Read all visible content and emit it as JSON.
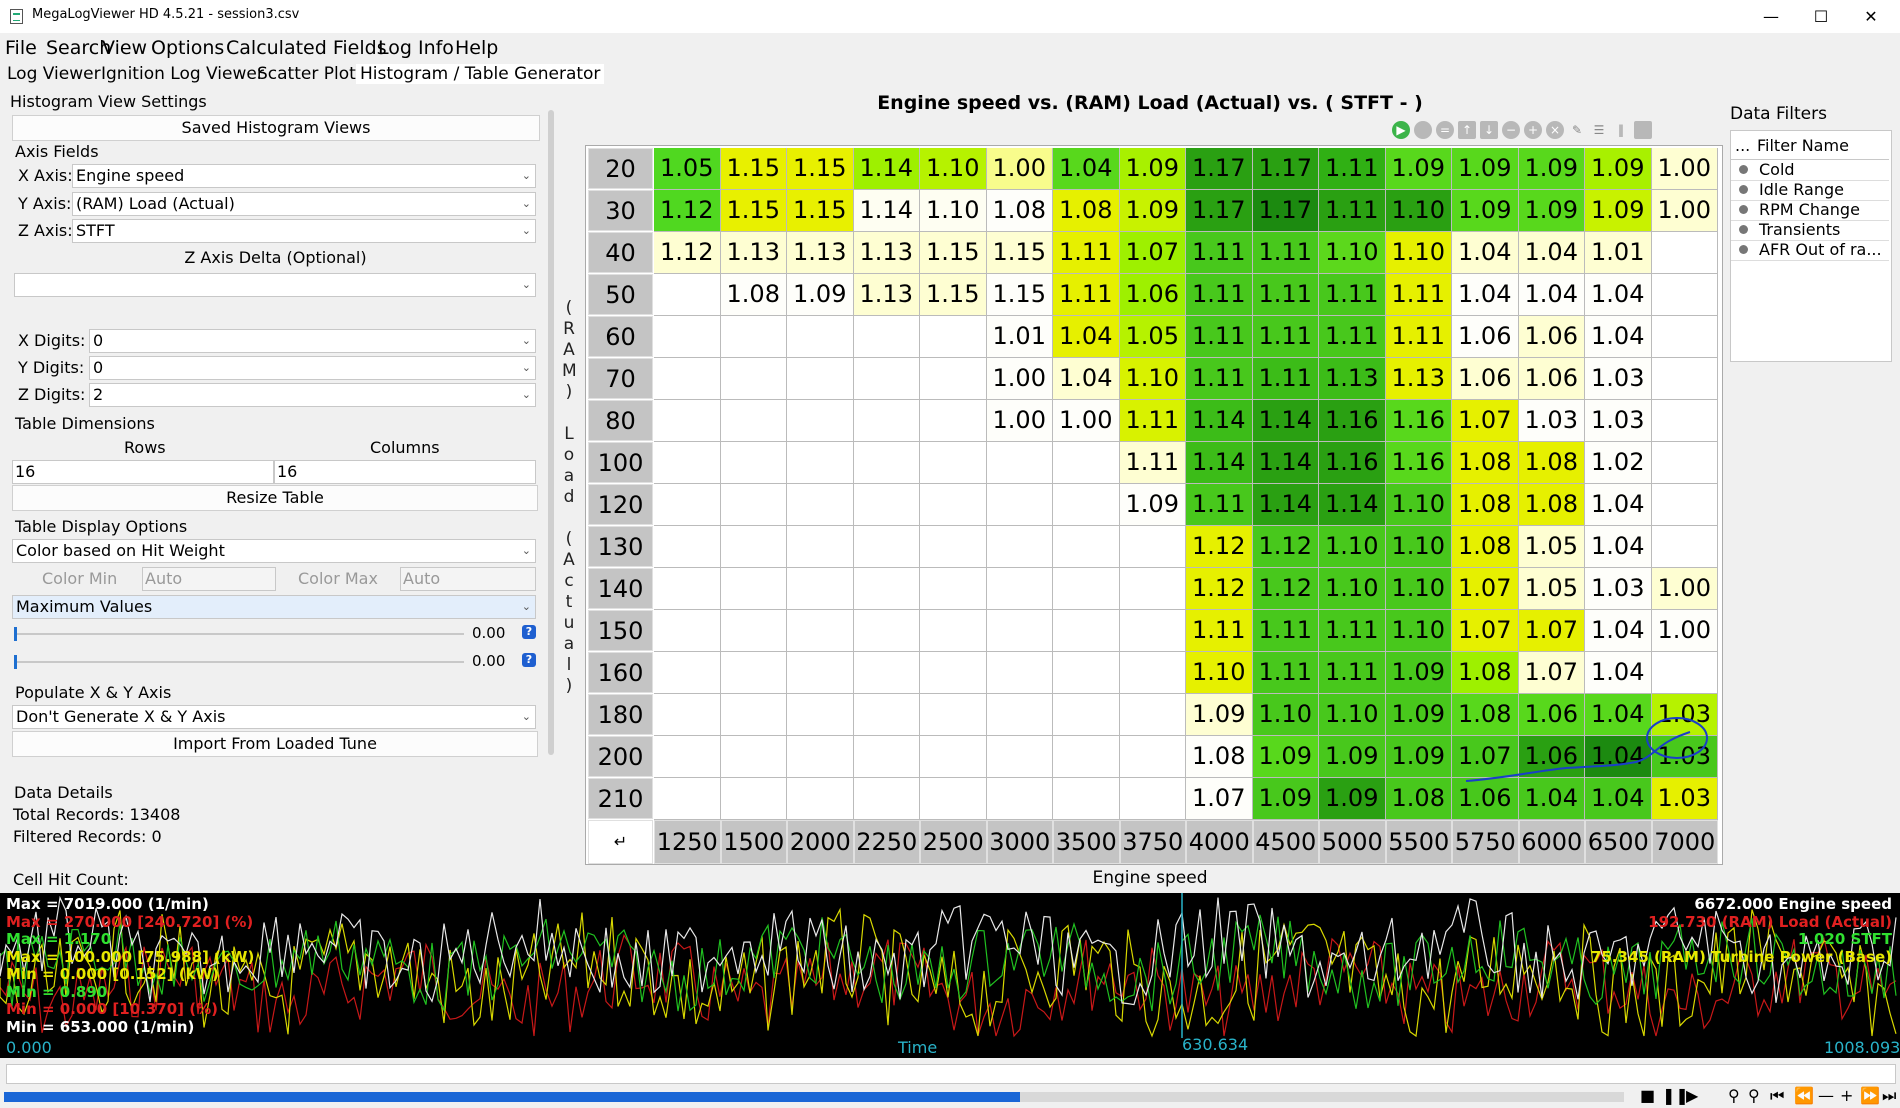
{
  "window": {
    "title": "MegaLogViewer HD 4.5.21 - session3.csv"
  },
  "menu": [
    "File",
    "Search",
    "View",
    "Options",
    "Calculated Fields",
    "Log Info",
    "Help"
  ],
  "tabs": [
    "Log Viewer",
    "Ignition Log Viewer",
    "Scatter Plots",
    "Histogram / Table Generator"
  ],
  "settings": {
    "header": "Histogram View Settings",
    "saved_views_button": "Saved Histogram Views",
    "axis_fields_label": "Axis Fields",
    "x_axis_label": "X Axis:",
    "x_axis_value": "Engine speed",
    "y_axis_label": "Y Axis:",
    "y_axis_value": "(RAM) Load (Actual)",
    "z_axis_label": "Z Axis:",
    "z_axis_value": "STFT",
    "z_delta_label": "Z Axis Delta (Optional)",
    "z_delta_value": "",
    "x_digits_label": "X Digits:",
    "x_digits_value": "0",
    "y_digits_label": "Y Digits:",
    "y_digits_value": "0",
    "z_digits_label": "Z Digits:",
    "z_digits_value": "2",
    "table_dimensions_label": "Table Dimensions",
    "rows_label": "Rows",
    "columns_label": "Columns",
    "rows_value": "16",
    "columns_value": "16",
    "resize_button": "Resize Table",
    "display_options_label": "Table Display Options",
    "color_mode": "Color based on Hit Weight",
    "color_min_label": "Color Min",
    "color_min_placeholder": "Auto",
    "color_max_label": "Color Max",
    "color_max_placeholder": "Auto",
    "value_mode": "Maximum Values",
    "slider1_value": "0.00",
    "slider2_value": "0.00",
    "populate_label": "Populate X & Y Axis",
    "populate_value": "Don't Generate X & Y Axis",
    "import_button": "Import From Loaded Tune",
    "data_details_label": "Data Details",
    "total_records": "Total Records: 13408",
    "filtered_records": "Filtered Records: 0",
    "cell_hit_count": "Cell Hit Count:"
  },
  "histogram": {
    "title": "Engine speed vs. (RAM) Load (Actual) vs. ( STFT -   )",
    "x_label": "Engine speed",
    "y_label": "(RAM) Load (Actual)",
    "corner_symbol": "↵",
    "x_values": [
      "1250",
      "1500",
      "2000",
      "2250",
      "2500",
      "3000",
      "3500",
      "3750",
      "4000",
      "4500",
      "5000",
      "5500",
      "5750",
      "6000",
      "6500",
      "7000"
    ],
    "y_values": [
      "20",
      "30",
      "40",
      "50",
      "60",
      "70",
      "80",
      "100",
      "120",
      "130",
      "140",
      "150",
      "160",
      "180",
      "200",
      "210"
    ],
    "cells": [
      [
        "1.05",
        "1.15",
        "1.15",
        "1.14",
        "1.10",
        "1.00",
        "1.04",
        "1.09",
        "1.17",
        "1.17",
        "1.11",
        "1.09",
        "1.09",
        "1.09",
        "1.09",
        "1.00"
      ],
      [
        "1.12",
        "1.15",
        "1.15",
        "1.14",
        "1.10",
        "1.08",
        "1.08",
        "1.09",
        "1.17",
        "1.17",
        "1.11",
        "1.10",
        "1.09",
        "1.09",
        "1.09",
        "1.00"
      ],
      [
        "1.12",
        "1.13",
        "1.13",
        "1.13",
        "1.15",
        "1.15",
        "1.11",
        "1.07",
        "1.11",
        "1.11",
        "1.10",
        "1.10",
        "1.04",
        "1.04",
        "1.01",
        ""
      ],
      [
        "",
        "1.08",
        "1.09",
        "1.13",
        "1.15",
        "1.15",
        "1.11",
        "1.06",
        "1.11",
        "1.11",
        "1.11",
        "1.11",
        "1.04",
        "1.04",
        "1.04",
        ""
      ],
      [
        "",
        "",
        "",
        "",
        "",
        "1.01",
        "1.04",
        "1.05",
        "1.11",
        "1.11",
        "1.11",
        "1.11",
        "1.06",
        "1.06",
        "1.04",
        ""
      ],
      [
        "",
        "",
        "",
        "",
        "",
        "1.00",
        "1.04",
        "1.10",
        "1.11",
        "1.11",
        "1.13",
        "1.13",
        "1.06",
        "1.06",
        "1.03",
        ""
      ],
      [
        "",
        "",
        "",
        "",
        "",
        "1.00",
        "1.00",
        "1.11",
        "1.14",
        "1.14",
        "1.16",
        "1.16",
        "1.07",
        "1.03",
        "1.03",
        ""
      ],
      [
        "",
        "",
        "",
        "",
        "",
        "",
        "",
        "1.11",
        "1.14",
        "1.14",
        "1.16",
        "1.16",
        "1.08",
        "1.08",
        "1.02",
        ""
      ],
      [
        "",
        "",
        "",
        "",
        "",
        "",
        "",
        "1.09",
        "1.11",
        "1.14",
        "1.14",
        "1.10",
        "1.08",
        "1.08",
        "1.04",
        ""
      ],
      [
        "",
        "",
        "",
        "",
        "",
        "",
        "",
        "",
        "1.12",
        "1.12",
        "1.10",
        "1.10",
        "1.08",
        "1.05",
        "1.04",
        ""
      ],
      [
        "",
        "",
        "",
        "",
        "",
        "",
        "",
        "",
        "1.12",
        "1.12",
        "1.10",
        "1.10",
        "1.07",
        "1.05",
        "1.03",
        "1.00"
      ],
      [
        "",
        "",
        "",
        "",
        "",
        "",
        "",
        "",
        "1.11",
        "1.11",
        "1.11",
        "1.10",
        "1.07",
        "1.07",
        "1.04",
        "1.00"
      ],
      [
        "",
        "",
        "",
        "",
        "",
        "",
        "",
        "",
        "1.10",
        "1.11",
        "1.11",
        "1.09",
        "1.08",
        "1.07",
        "1.04",
        ""
      ],
      [
        "",
        "",
        "",
        "",
        "",
        "",
        "",
        "",
        "1.09",
        "1.10",
        "1.10",
        "1.09",
        "1.08",
        "1.06",
        "1.04",
        "1.03"
      ],
      [
        "",
        "",
        "",
        "",
        "",
        "",
        "",
        "",
        "1.08",
        "1.09",
        "1.09",
        "1.09",
        "1.07",
        "1.06",
        "1.04",
        "1.03"
      ],
      [
        "",
        "",
        "",
        "",
        "",
        "",
        "",
        "",
        "1.07",
        "1.09",
        "1.09",
        "1.08",
        "1.06",
        "1.04",
        "1.04",
        "1.03"
      ]
    ],
    "heat_colors": [
      [
        "#50d820",
        "#e8f000",
        "#e8f000",
        "#9ef000",
        "#b6f200",
        "#f8fc8c",
        "#58d81c",
        "#a8f000",
        "#2aa012",
        "#2aa012",
        "#30b014",
        "#58d81c",
        "#58d81c",
        "#58d81c",
        "#a8f000",
        "#fefed2"
      ],
      [
        "#50d820",
        "#e8f000",
        "#e8f000",
        "#fefef2",
        "#fefef2",
        "#fefefa",
        "#e6f000",
        "#c8f200",
        "#2aa012",
        "#1c8a10",
        "#2aa012",
        "#2aa012",
        "#58d81c",
        "#58d81c",
        "#c8f200",
        "#fefed2"
      ],
      [
        "#fefed2",
        "#fefed2",
        "#fefed2",
        "#fefed2",
        "#fefed2",
        "#fefed2",
        "#e6f000",
        "#9ef000",
        "#48c81c",
        "#48c81c",
        "#5cd81c",
        "#e6f000",
        "#fefed2",
        "#fefed2",
        "#fefed2",
        "#ffffff"
      ],
      [
        "#ffffff",
        "#fefefa",
        "#fefefa",
        "#fefed2",
        "#fefed2",
        "#fefefa",
        "#e6f000",
        "#9ef000",
        "#48c81c",
        "#48c81c",
        "#48c81c",
        "#e6f000",
        "#fefefa",
        "#fefefa",
        "#fefefa",
        "#ffffff"
      ],
      [
        "#ffffff",
        "#ffffff",
        "#ffffff",
        "#ffffff",
        "#ffffff",
        "#fefefa",
        "#e6f000",
        "#b6f200",
        "#48c81c",
        "#48c81c",
        "#48c81c",
        "#e6f000",
        "#fefefa",
        "#fefed2",
        "#fefefa",
        "#ffffff"
      ],
      [
        "#ffffff",
        "#ffffff",
        "#ffffff",
        "#ffffff",
        "#ffffff",
        "#fefefa",
        "#fefed2",
        "#d8f200",
        "#48c81c",
        "#3cbc18",
        "#3cbc18",
        "#e6f000",
        "#fefed2",
        "#fefed2",
        "#fefefa",
        "#ffffff"
      ],
      [
        "#ffffff",
        "#ffffff",
        "#ffffff",
        "#ffffff",
        "#ffffff",
        "#fefefa",
        "#fefefa",
        "#d8f200",
        "#3cbc18",
        "#2aa012",
        "#2aa012",
        "#58d81c",
        "#e6f000",
        "#fefefa",
        "#fefefa",
        "#ffffff"
      ],
      [
        "#ffffff",
        "#ffffff",
        "#ffffff",
        "#ffffff",
        "#ffffff",
        "#ffffff",
        "#ffffff",
        "#fefed2",
        "#3cbc18",
        "#2aa012",
        "#2aa012",
        "#58d81c",
        "#e6f000",
        "#e6f000",
        "#fefefa",
        "#ffffff"
      ],
      [
        "#ffffff",
        "#ffffff",
        "#ffffff",
        "#ffffff",
        "#ffffff",
        "#ffffff",
        "#ffffff",
        "#fefefa",
        "#48c81c",
        "#2aa012",
        "#2aa012",
        "#48c81c",
        "#e6f000",
        "#e6f000",
        "#fefefa",
        "#ffffff"
      ],
      [
        "#ffffff",
        "#ffffff",
        "#ffffff",
        "#ffffff",
        "#ffffff",
        "#ffffff",
        "#ffffff",
        "#ffffff",
        "#e6f000",
        "#48c81c",
        "#48c81c",
        "#48c81c",
        "#e6f000",
        "#fefed2",
        "#fefefa",
        "#ffffff"
      ],
      [
        "#ffffff",
        "#ffffff",
        "#ffffff",
        "#ffffff",
        "#ffffff",
        "#ffffff",
        "#ffffff",
        "#ffffff",
        "#e6f000",
        "#48c81c",
        "#48c81c",
        "#48c81c",
        "#e6f000",
        "#fefed2",
        "#fefefa",
        "#fefed2"
      ],
      [
        "#ffffff",
        "#ffffff",
        "#ffffff",
        "#ffffff",
        "#ffffff",
        "#ffffff",
        "#ffffff",
        "#ffffff",
        "#e6f000",
        "#48c81c",
        "#48c81c",
        "#48c81c",
        "#e6f000",
        "#e6f000",
        "#fefefa",
        "#fefefa"
      ],
      [
        "#ffffff",
        "#ffffff",
        "#ffffff",
        "#ffffff",
        "#ffffff",
        "#ffffff",
        "#ffffff",
        "#ffffff",
        "#e6f000",
        "#48c81c",
        "#48c81c",
        "#48c81c",
        "#9ef000",
        "#fefed2",
        "#fefefa",
        "#ffffff"
      ],
      [
        "#ffffff",
        "#ffffff",
        "#ffffff",
        "#ffffff",
        "#ffffff",
        "#ffffff",
        "#ffffff",
        "#ffffff",
        "#fefed2",
        "#48c81c",
        "#48c81c",
        "#48c81c",
        "#58d81c",
        "#58d81c",
        "#58d81c",
        "#b6f200"
      ],
      [
        "#ffffff",
        "#ffffff",
        "#ffffff",
        "#ffffff",
        "#ffffff",
        "#ffffff",
        "#ffffff",
        "#ffffff",
        "#fefefa",
        "#58d81c",
        "#48c81c",
        "#48c81c",
        "#48c81c",
        "#2aa012",
        "#1c8a10",
        "#48c81c"
      ],
      [
        "#ffffff",
        "#ffffff",
        "#ffffff",
        "#ffffff",
        "#ffffff",
        "#ffffff",
        "#ffffff",
        "#ffffff",
        "#fefefa",
        "#48c81c",
        "#2aa012",
        "#48c81c",
        "#48c81c",
        "#48c81c",
        "#48c81c",
        "#e6f000"
      ]
    ]
  },
  "filters": {
    "header": "Data Filters",
    "column_header_dots": "...",
    "column_header": "Filter Name",
    "items": [
      "Cold",
      "Idle Range",
      "RPM Change",
      "Transients",
      "AFR Out of ra..."
    ]
  },
  "graph": {
    "left_labels": [
      {
        "text": "Max = 7019.000 (1/min)",
        "color": "#ffffff"
      },
      {
        "text": "Max = 270.000 [240.720] (%)",
        "color": "#e02020"
      },
      {
        "text": "Max = 1.170",
        "color": "#30e030"
      },
      {
        "text": "Max = 100.000 [75.988] (kW)",
        "color": "#e8e800"
      },
      {
        "text": "Min = 0.000 [0.152] (kW)",
        "color": "#e8e800"
      },
      {
        "text": "Min = 0.890",
        "color": "#30e030"
      },
      {
        "text": "Min = 0.000 [10.370] (%)",
        "color": "#e02020"
      },
      {
        "text": "Min = 653.000 (1/min)",
        "color": "#ffffff"
      }
    ],
    "right_labels": [
      {
        "text": "6672.000  Engine speed",
        "color": "#ffffff"
      },
      {
        "text": "192.730  (RAM) Load (Actual)",
        "color": "#e02020"
      },
      {
        "text": "1.020  STFT",
        "color": "#30e030"
      },
      {
        "text": "75.345  (RAM) Turbine Power (Base)",
        "color": "#e8e800"
      }
    ]
  },
  "timeline": {
    "start": "0.000",
    "label": "Time",
    "cursor": "630.634",
    "end": "1008.093"
  },
  "playback": {
    "progress": 0.627
  }
}
